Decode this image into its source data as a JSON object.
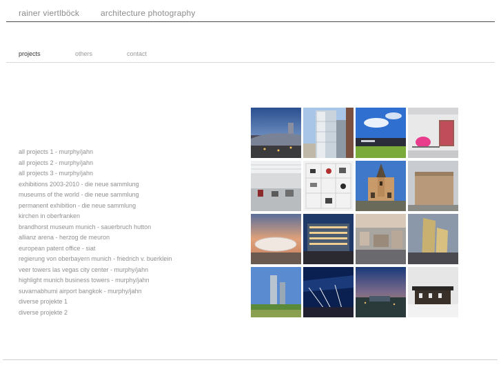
{
  "header": {
    "name": "rainer viertlböck",
    "tagline": "architecture photography"
  },
  "nav": {
    "projects": "projects",
    "others": "others",
    "contact": "contact",
    "active": "projects"
  },
  "projects": [
    "all projects 1 - murphy/jahn",
    "all projects 2 - murphy/jahn",
    "all projects 3 - murphy/jahn",
    "exhibitions 2003-2010 - die neue sammlung",
    "museums of the world - die neue sammlung",
    "permanent exhibition - die neue sammlung",
    "kirchen in oberfranken",
    "brandhorst museum munich - sauerbruch hutton",
    "allianz arena - herzog de meuron",
    "european patent office - siat",
    "regierung von oberbayern munich - friedrich v. buerklein",
    "veer towers las vegas city center - murphy/jahn",
    "highlight munich business towers - murphy/jahn",
    "suvarnabhumi airport bangkok - murphy/jahn",
    "diverse projekte 1",
    "diverse projekte 2"
  ],
  "colors": {
    "text": "#8f8f8f",
    "active_nav": "#333333",
    "header_rule": "#4a4a4a",
    "light_rule": "#d8d8d8"
  }
}
